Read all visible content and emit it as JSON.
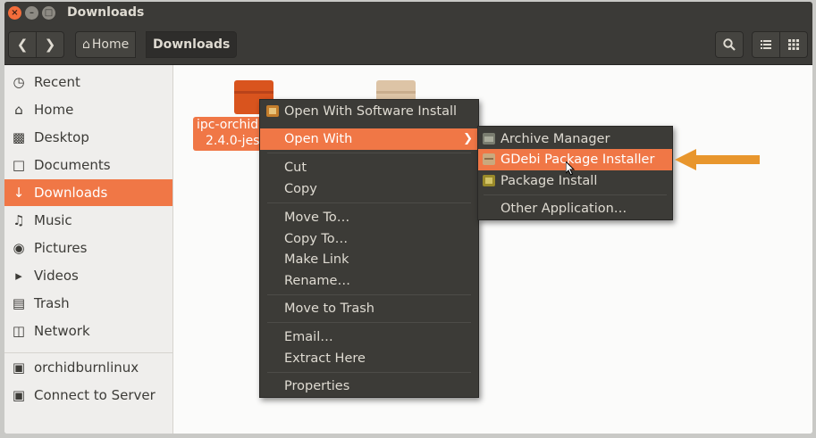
{
  "window": {
    "title": "Downloads"
  },
  "toolbar": {
    "back_icon": "chevron-left-icon",
    "forward_icon": "chevron-right-icon",
    "breadcrumbs": [
      "Home",
      "Downloads"
    ]
  },
  "sidebar": {
    "items": [
      {
        "label": "Recent",
        "icon": "clock-icon"
      },
      {
        "label": "Home",
        "icon": "home-icon"
      },
      {
        "label": "Desktop",
        "icon": "folder-icon"
      },
      {
        "label": "Documents",
        "icon": "document-icon"
      },
      {
        "label": "Downloads",
        "icon": "download-icon"
      },
      {
        "label": "Music",
        "icon": "music-icon"
      },
      {
        "label": "Pictures",
        "icon": "camera-icon"
      },
      {
        "label": "Videos",
        "icon": "video-icon"
      },
      {
        "label": "Trash",
        "icon": "trash-icon"
      },
      {
        "label": "Network",
        "icon": "network-icon"
      },
      {
        "label": "orchidburnlinux",
        "icon": "drive-icon"
      },
      {
        "label": "Connect to Server",
        "icon": "server-icon"
      }
    ],
    "active": "Downloads"
  },
  "files": [
    {
      "name_line1": "ipc-orchid",
      "name_line2": "2.4.0-jess",
      "selected": true
    },
    {
      "name_line1": "",
      "name_line2": "",
      "selected": false
    }
  ],
  "context_menu": {
    "items": [
      {
        "label": "Open With Software Install",
        "icon": "software-install-icon"
      },
      {
        "label": "Open With",
        "highlighted": true,
        "submenu": true
      },
      {
        "label": "Cut"
      },
      {
        "label": "Copy"
      },
      {
        "label": "Move To…"
      },
      {
        "label": "Copy To…"
      },
      {
        "label": "Make Link"
      },
      {
        "label": "Rename…"
      },
      {
        "label": "Move to Trash"
      },
      {
        "label": "Email…"
      },
      {
        "label": "Extract Here"
      },
      {
        "label": "Properties"
      }
    ]
  },
  "submenu": {
    "items": [
      {
        "label": "Archive Manager",
        "icon": "archive-manager-icon"
      },
      {
        "label": "GDebi Package Installer",
        "icon": "gdebi-icon",
        "highlighted": true
      },
      {
        "label": "Package Install",
        "icon": "package-install-icon"
      },
      {
        "label": "Other Application…"
      }
    ]
  },
  "colors": {
    "accent": "#f07746",
    "menu_bg": "#3c3b37",
    "titlebar_bg": "#3b3a37",
    "pointer_arrow": "#e8962d"
  }
}
